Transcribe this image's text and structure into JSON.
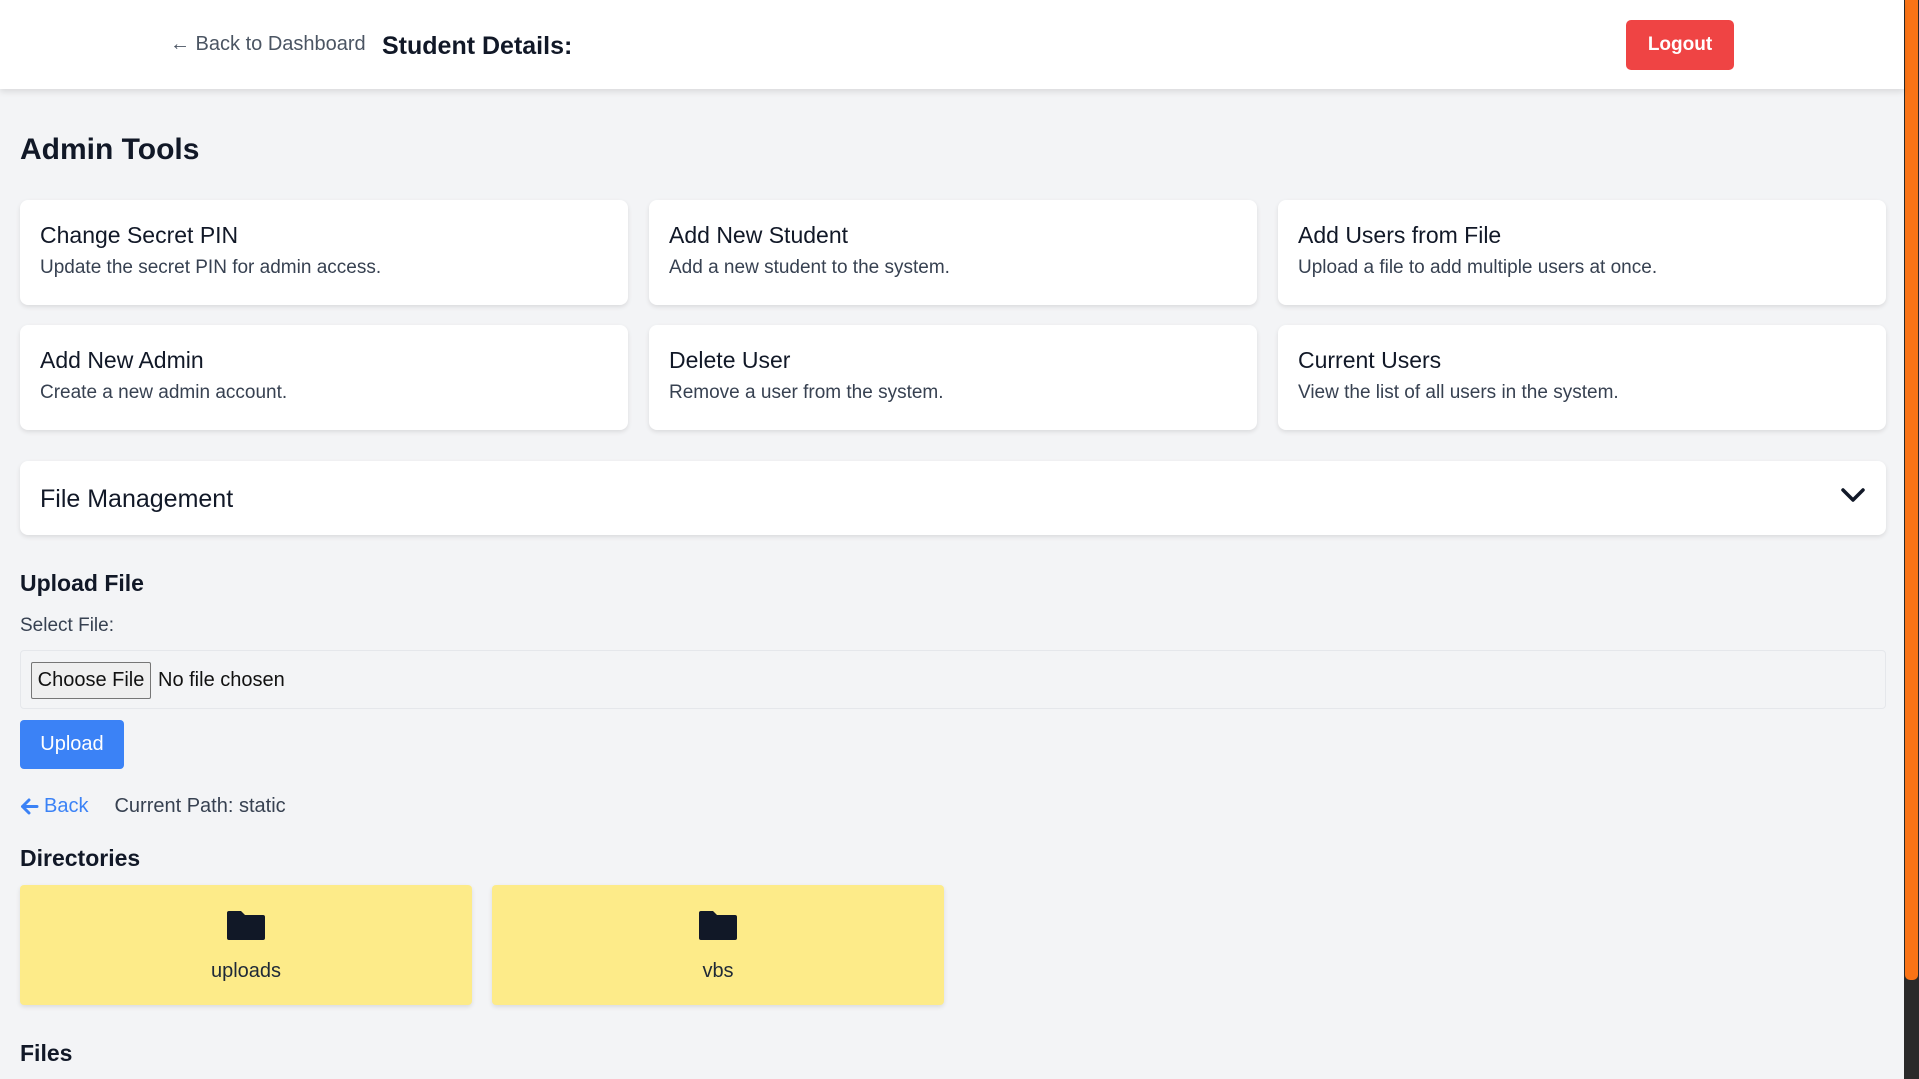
{
  "header": {
    "back_label": "← Back to Dashboard",
    "title": "Student Details:",
    "logout_label": "Logout"
  },
  "admin_tools": {
    "title": "Admin Tools",
    "cards": [
      {
        "title": "Change Secret PIN",
        "description": "Update the secret PIN for admin access."
      },
      {
        "title": "Add New Student",
        "description": "Add a new student to the system."
      },
      {
        "title": "Add Users from File",
        "description": "Upload a file to add multiple users at once."
      },
      {
        "title": "Add New Admin",
        "description": "Create a new admin account."
      },
      {
        "title": "Delete User",
        "description": "Remove a user from the system."
      },
      {
        "title": "Current Users",
        "description": "View the list of all users in the system."
      }
    ]
  },
  "file_management": {
    "title": "File Management",
    "upload_title": "Upload File",
    "select_label": "Select File:",
    "choose_button": "Choose File",
    "no_file_text": "No file chosen",
    "upload_button": "Upload",
    "back_label": "Back",
    "current_path": "Current Path: static",
    "directories_title": "Directories",
    "directories": [
      "uploads",
      "vbs"
    ],
    "files_title": "Files"
  },
  "colors": {
    "logout": "#ef4444",
    "primary": "#3b82f6",
    "folder_card": "#fdeb89",
    "scroll_thumb": "#f97316"
  }
}
